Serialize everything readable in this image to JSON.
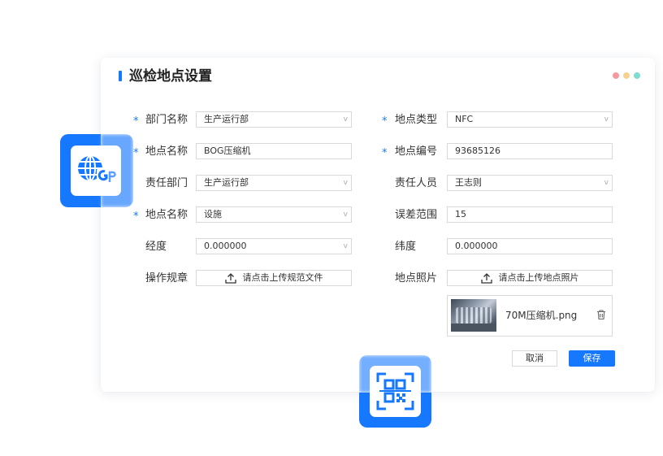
{
  "form": {
    "title": "巡检地点设置",
    "required_mark": "*",
    "fields": [
      {
        "key": "dept_name",
        "label": "部门名称",
        "value": "生产运行部",
        "type": "select",
        "required": true
      },
      {
        "key": "loc_type",
        "label": "地点类型",
        "value": "NFC",
        "type": "select",
        "required": true
      },
      {
        "key": "loc_name",
        "label": "地点名称",
        "value": "BOG压缩机",
        "type": "text",
        "required": true
      },
      {
        "key": "loc_code",
        "label": "地点编号",
        "value": "93685126",
        "type": "text",
        "required": true
      },
      {
        "key": "resp_dept",
        "label": "责任部门",
        "value": "生产运行部",
        "type": "select",
        "required": false
      },
      {
        "key": "resp_person",
        "label": "责任人员",
        "value": "王志则",
        "type": "select",
        "required": false
      },
      {
        "key": "loc_name2",
        "label": "地点名称",
        "value": "设施",
        "type": "select",
        "required": true
      },
      {
        "key": "error_range",
        "label": "误差范围",
        "value": "15",
        "type": "text",
        "required": false
      },
      {
        "key": "longitude",
        "label": "经度",
        "value": "0.000000",
        "type": "select",
        "required": false
      },
      {
        "key": "latitude",
        "label": "纬度",
        "value": "0.000000",
        "type": "text",
        "required": false
      },
      {
        "key": "rules",
        "label": "操作规章",
        "value": "请点击上传规范文件",
        "type": "upload",
        "required": false
      },
      {
        "key": "photo",
        "label": "地点照片",
        "value": "请点击上传地点照片",
        "type": "upload",
        "required": false
      }
    ],
    "attachment": {
      "filename": "70M压缩机.png"
    },
    "buttons": {
      "cancel": "取消",
      "save": "保存"
    }
  },
  "icons": {
    "arrow": "v",
    "gps_tile": "gps-icon",
    "qr_tile": "qr-code-icon",
    "upload": "upload-icon",
    "trash": "trash-icon"
  },
  "colors": {
    "accent": "#1677ff",
    "window_dots": [
      "#f59a9f",
      "#f5d08e",
      "#7fdcd0"
    ]
  }
}
